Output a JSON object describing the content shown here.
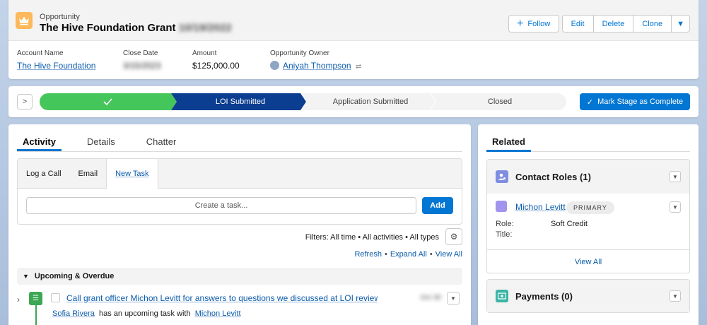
{
  "header": {
    "object_type": "Opportunity",
    "title": "The Hive Foundation Grant",
    "title_suffix_blurred": "10/19/2022",
    "buttons": {
      "follow": "Follow",
      "edit": "Edit",
      "delete": "Delete",
      "clone": "Clone"
    },
    "fields": [
      {
        "label": "Account Name",
        "value": "The Hive Foundation"
      },
      {
        "label": "Close Date",
        "value": "3/15/2023"
      },
      {
        "label": "Amount",
        "value": "$125,000.00"
      },
      {
        "label": "Opportunity Owner",
        "value": "Aniyah Thompson"
      }
    ]
  },
  "path": {
    "stages": [
      "LOI Submitted",
      "Application Submitted",
      "Closed"
    ],
    "completed_count": 1,
    "current_index": 1,
    "mark_complete": "Mark Stage as Complete",
    "colors": {
      "complete": "#45c65a",
      "current": "#0b3d91",
      "upcoming": "#f3f3f3"
    }
  },
  "activity": {
    "tabs": [
      "Activity",
      "Details",
      "Chatter"
    ],
    "composer_tabs": [
      "Log a Call",
      "Email",
      "New Task"
    ],
    "task_placeholder": "Create a task...",
    "add_label": "Add",
    "filters": "Filters: All time • All activities • All types",
    "links": [
      "Refresh",
      "Expand All",
      "View All"
    ],
    "section_title": "Upcoming & Overdue",
    "task": {
      "subject": "Call grant officer Michon Levitt for answers to questions we discussed at LOI review me...",
      "date_blurred": "Oct 30",
      "assignee": "Sofia Rivera",
      "middle_text": "has an upcoming task with",
      "contact": "Michon Levitt"
    }
  },
  "related": {
    "tab": "Related",
    "contact_roles": {
      "title": "Contact Roles (1)",
      "contact_name": "Michon Levitt",
      "badge": "PRIMARY",
      "role_label": "Role:",
      "role_value": "Soft Credit",
      "title_label": "Title:",
      "view_all": "View All"
    },
    "payments": {
      "title": "Payments (0)"
    }
  },
  "icons": [
    "crown-icon",
    "plus-icon",
    "chevron-down-icon",
    "user-icon",
    "chevron-right-icon",
    "check-icon",
    "gear-icon",
    "task-icon",
    "contact-roles-icon",
    "payments-icon"
  ]
}
